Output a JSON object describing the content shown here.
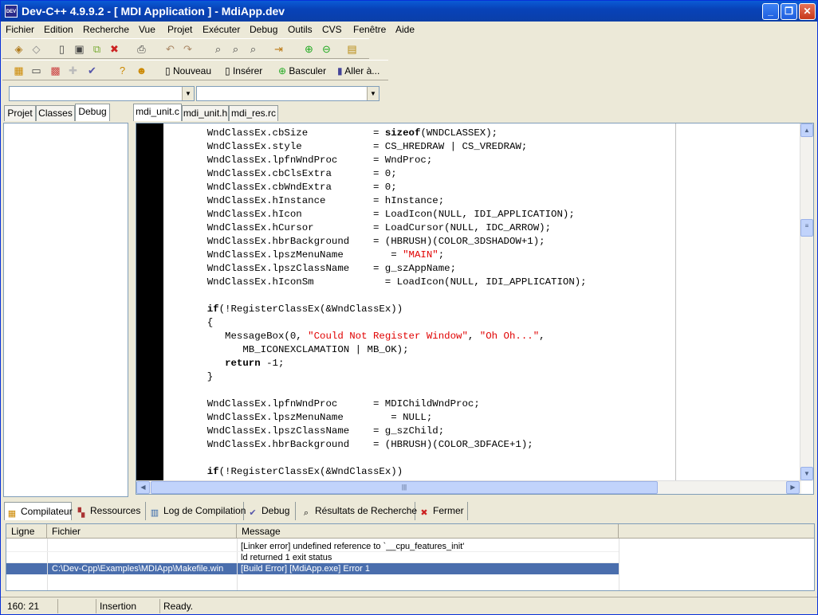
{
  "window": {
    "title": "Dev-C++ 4.9.9.2  -  [ MDI Application ] - MdiApp.dev",
    "app_icon_text": "DEV"
  },
  "title_buttons": {
    "minimize": "_",
    "maximize": "❐",
    "close": "✕"
  },
  "menu": [
    "Fichier",
    "Edition",
    "Recherche",
    "Vue",
    "Projet",
    "Exécuter",
    "Debug",
    "Outils",
    "CVS",
    "Fenêtre",
    "Aide"
  ],
  "toolbar2": {
    "new_label": "Nouveau",
    "insert_label": "Insérer",
    "toggle_label": "Basculer",
    "goto_label": "Aller à..."
  },
  "combos": {
    "classes_value": "",
    "members_value": ""
  },
  "left_tabs": [
    "Projet",
    "Classes",
    "Debug"
  ],
  "editor_tabs": [
    "mdi_unit.c",
    "mdi_unit.h",
    "mdi_res.rc"
  ],
  "code_lines": [
    "    WndClassEx.cbSize           = sizeof(WNDCLASSEX);",
    "    WndClassEx.style            = CS_HREDRAW | CS_VREDRAW;",
    "    WndClassEx.lpfnWndProc      = WndProc;",
    "    WndClassEx.cbClsExtra       = 0;",
    "    WndClassEx.cbWndExtra       = 0;",
    "    WndClassEx.hInstance        = hInstance;",
    "    WndClassEx.hIcon            = LoadIcon(NULL, IDI_APPLICATION);",
    "    WndClassEx.hCursor          = LoadCursor(NULL, IDC_ARROW);",
    "    WndClassEx.hbrBackground    = (HBRUSH)(COLOR_3DSHADOW+1);",
    "    WndClassEx.lpszMenuName        = \"MAIN\";",
    "    WndClassEx.lpszClassName    = g_szAppName;",
    "    WndClassEx.hIconSm            = LoadIcon(NULL, IDI_APPLICATION);",
    "",
    "    if(!RegisterClassEx(&WndClassEx))",
    "    {",
    "       MessageBox(0, \"Could Not Register Window\", \"Oh Oh...\",",
    "          MB_ICONEXCLAMATION | MB_OK);",
    "       return -1;",
    "    }",
    "",
    "    WndClassEx.lpfnWndProc      = MDIChildWndProc;",
    "    WndClassEx.lpszMenuName        = NULL;",
    "    WndClassEx.lpszClassName    = g_szChild;",
    "    WndClassEx.hbrBackground    = (HBRUSH)(COLOR_3DFACE+1);",
    "",
    "    if(!RegisterClassEx(&WndClassEx))"
  ],
  "hscroll_grip": "|||",
  "bottom_tabs": [
    "Compilateur",
    "Ressources",
    "Log de Compilation",
    "Debug",
    "Résultats de Recherche",
    "Fermer"
  ],
  "messages": {
    "headers": [
      "Ligne",
      "Fichier",
      "Message"
    ],
    "rows": [
      {
        "line": "",
        "file": "",
        "message": "[Linker error] undefined reference to `__cpu_features_init'"
      },
      {
        "line": "",
        "file": "",
        "message": "ld returned 1 exit status"
      },
      {
        "line": "",
        "file": "C:\\Dev-Cpp\\Examples\\MDIApp\\Makefile.win",
        "message": "[Build Error]  [MdiApp.exe] Error 1"
      }
    ]
  },
  "status": {
    "position": "160: 21",
    "modified": "",
    "mode": "Insertion",
    "message": "Ready."
  },
  "colors": {
    "titlebar": "#0a5bd6",
    "selection": "#4a6ead",
    "string": "#e00000"
  }
}
